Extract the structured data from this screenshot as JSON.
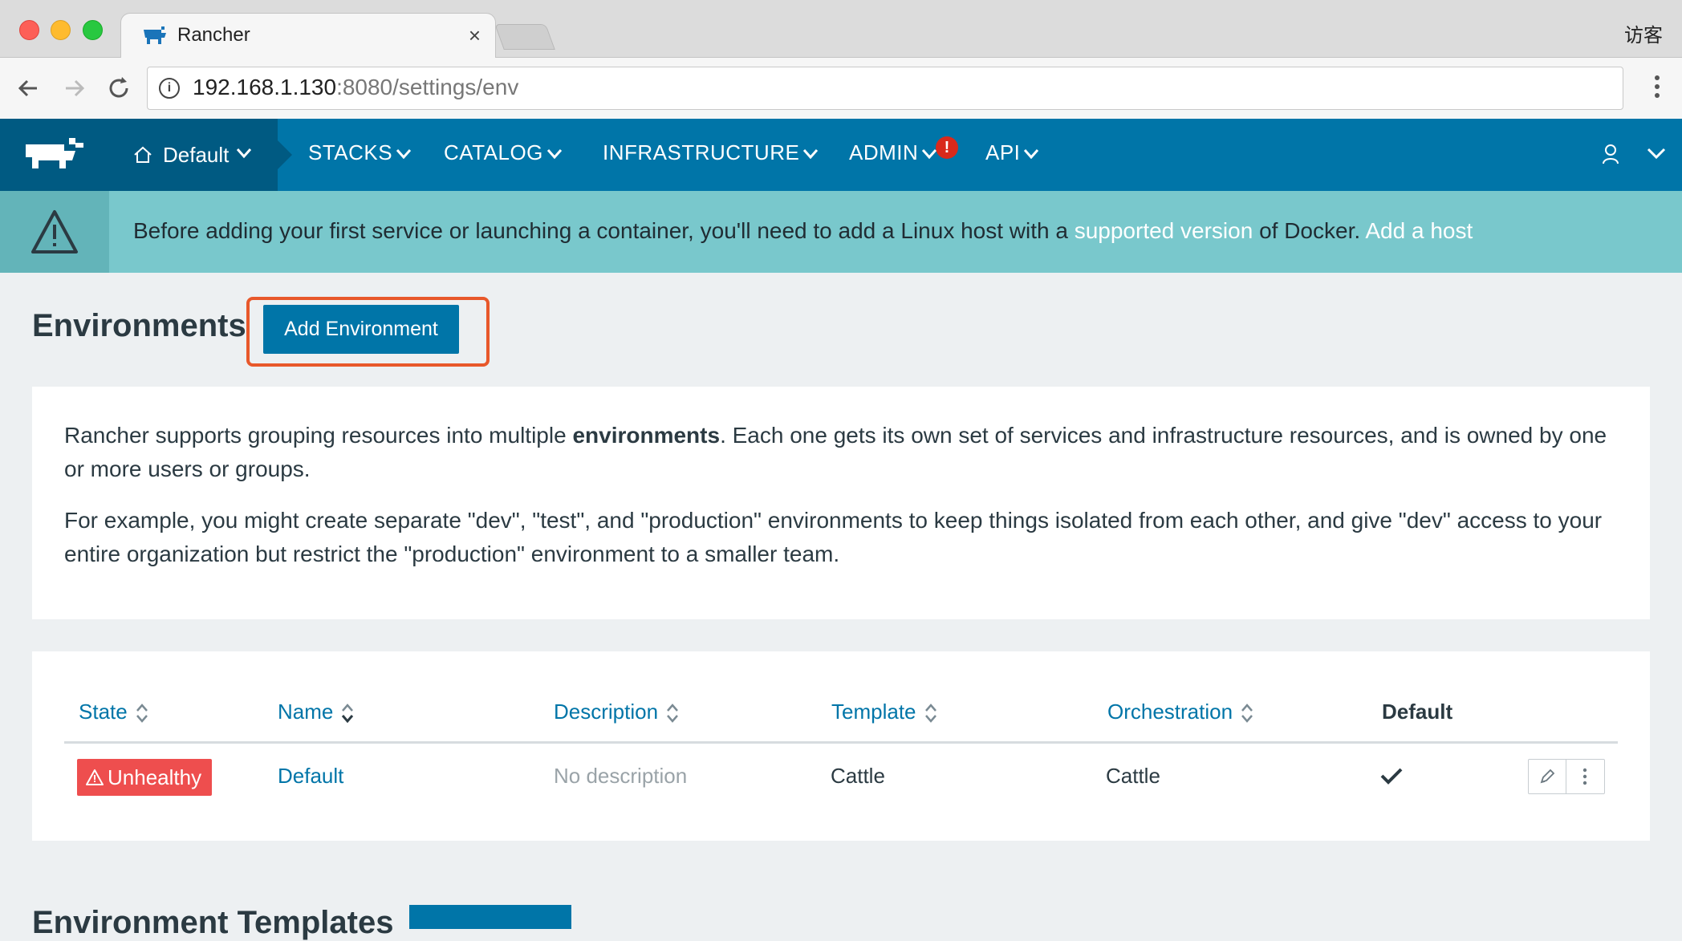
{
  "browser": {
    "tab_title": "Rancher",
    "tab_close": "×",
    "guest_label": "访客",
    "url_host": "192.168.1.130",
    "url_rest": ":8080/settings/env"
  },
  "header": {
    "env_switcher": "Default",
    "menu": {
      "stacks": "STACKS",
      "catalog": "CATALOG",
      "infrastructure": "INFRASTRUCTURE",
      "admin": "ADMIN",
      "api": "API"
    },
    "admin_badge": "!"
  },
  "banner": {
    "text_before": "Before adding your first service or launching a container, you'll need to add a Linux host with a ",
    "link_supported": "supported version",
    "text_middle": " of Docker. ",
    "link_add_host": "Add a host"
  },
  "page": {
    "title": "Environments",
    "add_button": "Add Environment"
  },
  "intro": {
    "p1_before": "Rancher supports grouping resources into multiple ",
    "p1_bold": "environments",
    "p1_after": ". Each one gets its own set of services and infrastructure resources, and is owned by one or more users or groups.",
    "p2": "For example, you might create separate \"dev\", \"test\", and \"production\" environments to keep things isolated from each other, and give \"dev\" access to your entire organization but restrict the \"production\" environment to a smaller team."
  },
  "table": {
    "columns": [
      "State",
      "Name",
      "Description",
      "Template",
      "Orchestration",
      "Default"
    ],
    "rows": [
      {
        "state": "Unhealthy",
        "name": "Default",
        "description": "No description",
        "template": "Cattle",
        "orchestration": "Cattle",
        "is_default": true
      }
    ]
  },
  "section2": {
    "title": "Environment Templates"
  },
  "colors": {
    "brand_blue": "#0075a8",
    "brand_dark": "#005a82",
    "banner_bg": "#79c8cc",
    "error_red": "#ee4e4e",
    "highlight_orange": "#e8582b"
  }
}
